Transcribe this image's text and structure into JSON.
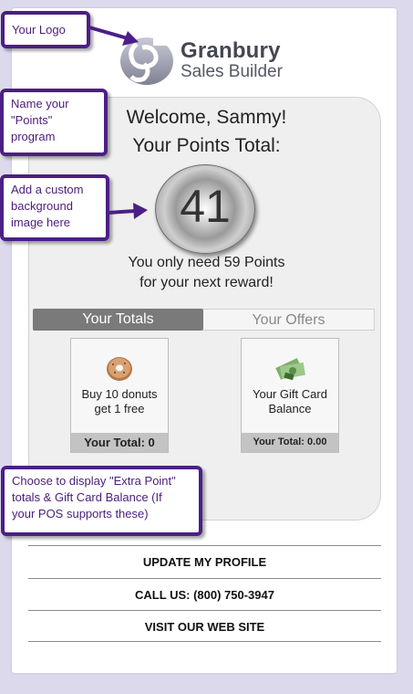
{
  "logo": {
    "name": "Granbury",
    "subtitle": "Sales Builder"
  },
  "rewards": {
    "welcome": "Welcome, Sammy!",
    "points_title": "Your Points Total:",
    "points_value": "41",
    "need_line1": "You only need 59 Points",
    "need_line2": "for your next reward!"
  },
  "tabs": [
    {
      "label": "Your Totals",
      "active": true
    },
    {
      "label": "Your Offers",
      "active": false
    }
  ],
  "boxes": [
    {
      "icon": "donut-icon",
      "line1": "Buy 10 donuts",
      "line2": "get 1 free",
      "total": "Your Total: 0"
    },
    {
      "icon": "gift-card-money-icon",
      "line1": "Your Gift Card",
      "line2": "Balance",
      "total": "Your Total: 0.00"
    }
  ],
  "links": [
    {
      "label": "UPDATE MY PROFILE"
    },
    {
      "label": "CALL US: (800) 750-3947"
    },
    {
      "label": "VISIT OUR WEB SITE"
    }
  ],
  "callouts": {
    "logo": "Your Logo",
    "program": [
      "Name your",
      "\"Points\"",
      "program"
    ],
    "background": [
      "Add a custom",
      "background",
      "image here"
    ],
    "extra": [
      "Choose to display \"Extra Point\"",
      "totals & Gift Card Balance (If",
      "your POS supports these)"
    ]
  },
  "colors": {
    "page_background": "#dcd9ec",
    "callout_border": "#4b1f86",
    "callout_text": "#4b1d7a",
    "active_tab": "#7a7a7a",
    "total_bar": "#c3c3c3"
  }
}
